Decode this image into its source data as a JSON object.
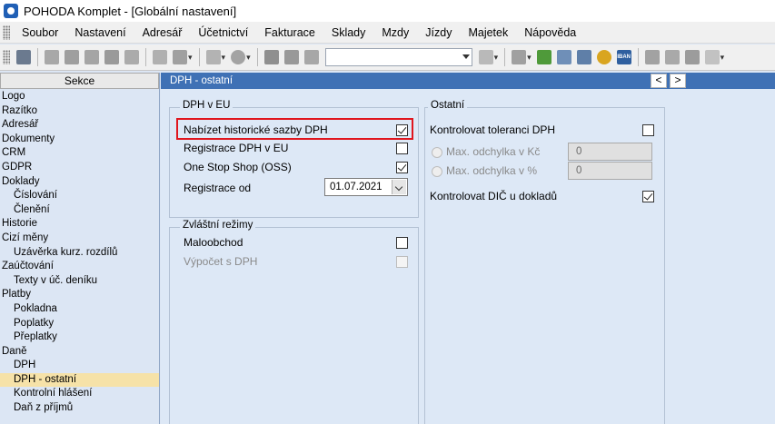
{
  "window": {
    "title": "POHODA Komplet - [Globální nastavení]"
  },
  "menu": [
    {
      "label": "Soubor"
    },
    {
      "label": "Nastavení"
    },
    {
      "label": "Adresář"
    },
    {
      "label": "Účetnictví"
    },
    {
      "label": "Fakturace"
    },
    {
      "label": "Sklady"
    },
    {
      "label": "Mzdy"
    },
    {
      "label": "Jízdy"
    },
    {
      "label": "Majetek"
    },
    {
      "label": "Nápověda"
    }
  ],
  "toolbar": {
    "search_value": "",
    "icons": [
      "grip-icon",
      "new-icon",
      "copy-icon",
      "print-icon",
      "preview-icon",
      "export-icon",
      "doc-icon",
      "check-icon",
      "back-icon",
      "settings-icon",
      "save-icon",
      "delete-icon",
      "list-icon",
      "filter-icon",
      "folder-icon",
      "money-icon",
      "calc-icon",
      "calculator-icon",
      "coins-icon",
      "iban-icon",
      "message-icon",
      "window-icon",
      "chat-icon",
      "help-icon"
    ],
    "iban_label": "IBAN"
  },
  "sidebar": {
    "header": "Sekce",
    "items": [
      {
        "label": "Logo",
        "level": 0
      },
      {
        "label": "Razítko",
        "level": 0
      },
      {
        "label": "Adresář",
        "level": 0
      },
      {
        "label": "Dokumenty",
        "level": 0
      },
      {
        "label": "CRM",
        "level": 0
      },
      {
        "label": "GDPR",
        "level": 0
      },
      {
        "label": "Doklady",
        "level": 0
      },
      {
        "label": "Číslování",
        "level": 1
      },
      {
        "label": "Členění",
        "level": 1
      },
      {
        "label": "Historie",
        "level": 0
      },
      {
        "label": "Cizí měny",
        "level": 0
      },
      {
        "label": "Uzávěrka kurz. rozdílů",
        "level": 1
      },
      {
        "label": "Zaúčtování",
        "level": 0
      },
      {
        "label": "Texty v úč. deníku",
        "level": 1
      },
      {
        "label": "Platby",
        "level": 0
      },
      {
        "label": "Pokladna",
        "level": 1
      },
      {
        "label": "Poplatky",
        "level": 1
      },
      {
        "label": "Přeplatky",
        "level": 1
      },
      {
        "label": "Daně",
        "level": 0
      },
      {
        "label": "DPH",
        "level": 1
      },
      {
        "label": "DPH - ostatní",
        "level": 1,
        "selected": true
      },
      {
        "label": "Kontrolní hlášení",
        "level": 1
      },
      {
        "label": "Daň z příjmů",
        "level": 1
      }
    ]
  },
  "panel": {
    "title": "DPH - ostatní",
    "prev_label": "<",
    "next_label": ">",
    "dph_eu": {
      "title": "DPH v EU",
      "historic_rates_label": "Nabízet historické sazby DPH",
      "historic_rates_checked": true,
      "registration_label": "Registrace DPH v EU",
      "registration_checked": false,
      "oss_label": "One Stop Shop (OSS)",
      "oss_checked": true,
      "registration_from_label": "Registrace od",
      "registration_from_value": "01.07.2021"
    },
    "special": {
      "title": "Zvláštní režimy",
      "retail_label": "Maloobchod",
      "retail_checked": false,
      "calc_label": "Výpočet s DPH",
      "calc_checked": false
    },
    "other": {
      "title": "Ostatní",
      "tolerance_label": "Kontrolovat toleranci DPH",
      "tolerance_checked": false,
      "max_kc_label": "Max. odchylka v Kč",
      "max_kc_value": "0",
      "max_pct_label": "Max. odchylka v %",
      "max_pct_value": "0",
      "dic_label": "Kontrolovat DIČ u dokladů",
      "dic_checked": true
    }
  },
  "colors": {
    "accent": "#3f71b5",
    "highlight": "#e0161e",
    "selected": "#f6e2a8"
  }
}
